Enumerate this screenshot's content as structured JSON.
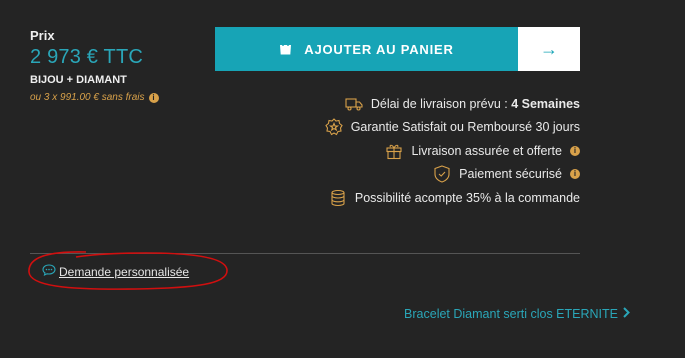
{
  "price": {
    "label": "Prix",
    "value": "2 973 € TTC",
    "description": "BIJOU + DIAMANT",
    "installment": "ou 3 x 991.00 € sans frais",
    "info_icon": "info-icon"
  },
  "actions": {
    "cart_label": "AJOUTER AU PANIER",
    "cart_icon": "bag-icon",
    "next_icon": "arrow-right-icon",
    "next_symbol": "→"
  },
  "features": [
    {
      "icon": "truck-icon",
      "text": "Délai de livraison prévu : ",
      "strong": "4 Semaines",
      "info": false
    },
    {
      "icon": "star-badge-icon",
      "text": "Garantie Satisfait ou Remboursé 30 jours",
      "strong": "",
      "info": false
    },
    {
      "icon": "gift-icon",
      "text": "Livraison assurée et offerte",
      "strong": "",
      "info": true
    },
    {
      "icon": "shield-icon",
      "text": "Paiement sécurisé",
      "strong": "",
      "info": true
    },
    {
      "icon": "coins-icon",
      "text": "Possibilité acompte 35% à la commande",
      "strong": "",
      "info": false
    }
  ],
  "request": {
    "label": "Demande personnalisée",
    "icon": "chat-icon"
  },
  "related": {
    "label": "Bracelet Diamant serti clos ETERNITE",
    "icon": "chevron-right-icon"
  },
  "colors": {
    "accent": "#17a4b6",
    "gold": "#d8a14a",
    "background": "#242424",
    "annotation": "#d10f0f"
  }
}
